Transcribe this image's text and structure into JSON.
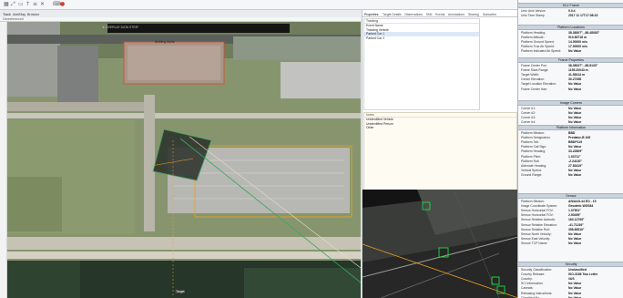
{
  "toolbar": {
    "tools": [
      "▦",
      "⤢",
      "▭",
      "↑",
      "≡",
      "✕",
      "⌨"
    ],
    "tools_red": "●"
  },
  "tabs": [
    "Track",
    "Add/Map",
    "Browser"
  ],
  "subbar_label": "Georeferenced",
  "map": {
    "top_label": "★ OVERLAY DATA STRIP",
    "box_label": "Building Alpha",
    "bottom_label": "Target"
  },
  "mid": {
    "tabs": [
      "Properties",
      "Target Details",
      "Observations",
      "KML",
      "Events",
      "Annotations",
      "Sharing",
      "Subscribe"
    ],
    "list_header": "Tracking",
    "list_rows": [
      "Event Name",
      "Tracking Vehicle",
      "Parked Car 1",
      "Parked Car 2"
    ],
    "notes_header": "Notes",
    "notes_rows": [
      "Unidentified Vehicle",
      "Unidentified Person",
      "Other"
    ]
  },
  "right": {
    "sections": [
      {
        "title": "KLV Frame",
        "rows": [
          [
            "Unix Unix Version",
            "9.0.4"
          ],
          [
            "Unix Time Stamp",
            "2017 11 17T17:08:23"
          ]
        ]
      },
      {
        "title": "Platform Locations",
        "rows": [
          [
            "Platform Heading:",
            "38.38007°, -86.48083°"
          ],
          [
            "Platform Altitude:",
            "913.85718 m"
          ],
          [
            "Platform Ground Speed:",
            "14.00000 m/s"
          ],
          [
            "Platform True Air Speed:",
            "17.00000 m/s"
          ],
          [
            "Platform Indicated Air Speed:",
            "No Value"
          ]
        ]
      },
      {
        "title": "Frame Properties",
        "rows": [
          [
            "Frame Center Pos:",
            "38.38027°, -86.8133°"
          ],
          [
            "Frame Slant Range:",
            "1195.20043 m"
          ],
          [
            "Target Width:",
            "41.58414 m"
          ],
          [
            "Center Elevation:",
            "30.27498"
          ],
          [
            "Target Location Elevation:",
            "No Value"
          ],
          [
            "Frame Center Hae:",
            "No Value"
          ]
        ]
      },
      {
        "title": "Image Corners",
        "rows": [
          [
            "Corner #1:",
            "No Value"
          ],
          [
            "Corner #2:",
            "No Value"
          ],
          [
            "Corner #3:",
            "No Value"
          ],
          [
            "Corner #4:",
            "No Value"
          ]
        ]
      },
      {
        "title": "Platform Information",
        "rows": [
          [
            "Platform Mission:",
            "BBD"
          ],
          [
            "Platform Designation:",
            "Predator-B 108"
          ],
          [
            "Platform Tail:",
            "BBDP119"
          ],
          [
            "Platform Call Sign:",
            "No Value"
          ],
          [
            "Platform Heading:",
            "33.22809°"
          ],
          [
            "Platform Pitch:",
            "1.03711°"
          ],
          [
            "Platform Roll:",
            "-2.24130°"
          ],
          [
            "Alternate Heading:",
            "27.83419°"
          ],
          [
            "Vertical Speed:",
            "No Value"
          ],
          [
            "Ground Range:",
            "No Value"
          ]
        ]
      },
      {
        "title": "Sensor",
        "rows": [
          [
            "Platform Mission:",
            "AN/AAS-44 EO - 19"
          ],
          [
            "Image Coordinate System:",
            "Geodetic WGS84"
          ],
          [
            "Sensor Horizontal FOV:",
            "1.07501°"
          ],
          [
            "Sensor Horizontal FOV:",
            "2.50499°"
          ],
          [
            "Sensor Relative Azimuth:",
            "164.12799°"
          ],
          [
            "Sensor Relative Elevation:",
            "-41.71239°"
          ],
          [
            "Sensor Relative Roll:",
            "358.89510°"
          ],
          [
            "Sensor North Velocity:",
            "No Value"
          ],
          [
            "Sensor East Velocity:",
            "No Value"
          ],
          [
            "Sensor TCP Name:",
            "No Value"
          ]
        ]
      },
      {
        "title": "Security",
        "rows": [
          [
            "Security Classification:",
            "Unclassified"
          ],
          [
            "Country Release:",
            "ISO-3166 Two Letter"
          ],
          [
            "Country:",
            "//US"
          ],
          [
            "SCI Information:",
            "No Value"
          ],
          [
            "Caveats:",
            "No Value"
          ],
          [
            "Releasing Instructions:",
            "No Value"
          ],
          [
            "Classified By:",
            "No Value"
          ]
        ]
      }
    ]
  },
  "colors": {
    "accent_orange": "#f0a020",
    "track_green": "#3aa85a",
    "detect_green": "#22dd44"
  }
}
